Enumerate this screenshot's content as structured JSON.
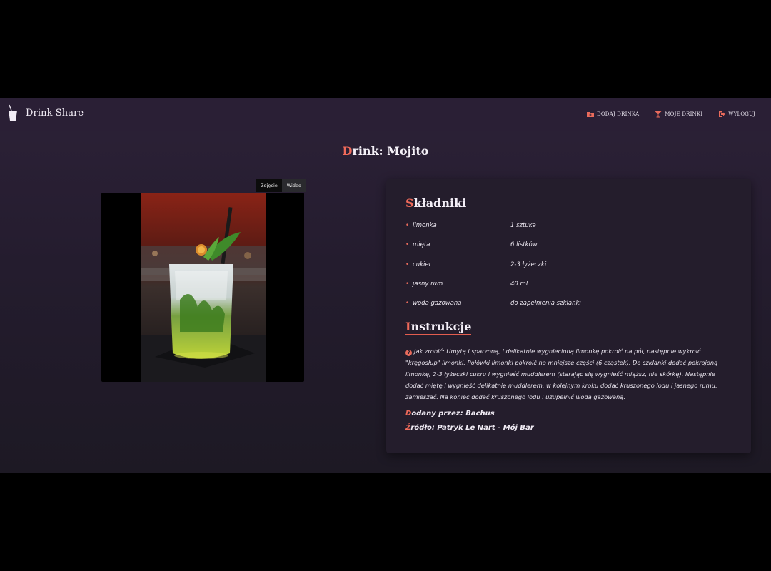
{
  "navbar": {
    "brand": "Drink Share",
    "links": [
      {
        "label": "DODAJ DRINKA",
        "icon": "folder-plus-icon"
      },
      {
        "label": "MOJE DRINKI",
        "icon": "cocktail-icon"
      },
      {
        "label": "WYLOGUJ",
        "icon": "logout-icon"
      }
    ]
  },
  "page": {
    "title_first_letter": "D",
    "title_rest": "rink: Mojito"
  },
  "media": {
    "tabs": [
      "Zdjęcie",
      "Wideo"
    ],
    "active_tab": "Zdjęcie"
  },
  "ingredients": {
    "title_first_letter": "S",
    "title_rest": "kładniki",
    "items": [
      {
        "name": "limonka",
        "amount": "1 sztuka"
      },
      {
        "name": "mięta",
        "amount": "6 listków"
      },
      {
        "name": "cukier",
        "amount": "2-3 łyżeczki"
      },
      {
        "name": "jasny rum",
        "amount": "40 ml"
      },
      {
        "name": "woda gazowana",
        "amount": "do zapełnienia szklanki"
      }
    ]
  },
  "instructions": {
    "title_first_letter": "I",
    "title_rest": "nstrukcje",
    "text": "Jak zrobić: Umytą i sparzoną, i delikatnie wygniecioną limonkę pokroić na pół, następnie wykroić \"kręgosłup\" limonki. Połówki limonki pokroić na mniejsze części (6 cząstek). Do szklanki dodać pokrojoną limonkę, 2-3 łyżeczki cukru i wygnieść muddlerem (starając się wygnieść miąższ, nie skórkę). Następnie dodać miętę i wygnieść delikatnie muddlerem, w kolejnym kroku dodać kruszonego lodu i jasnego rumu, zamieszać. Na koniec dodać kruszonego lodu i uzupełnić wodą gazowaną."
  },
  "meta": {
    "added_by_first_letter": "D",
    "added_by_rest": "odany przez: Bachus",
    "source_first_letter": "Ź",
    "source_rest": "ródło: Patryk Le Nart - Mój Bar"
  },
  "colors": {
    "accent": "#f06a5a",
    "background": "#241c2e",
    "card": "#241d2c"
  }
}
